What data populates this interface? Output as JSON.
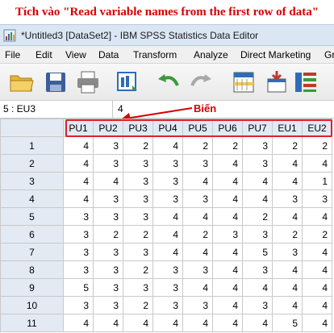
{
  "caption": "Tích vào \"Read variable names from the first row of data\"",
  "window": {
    "title": "*Untitled3 [DataSet2] - IBM SPSS Statistics Data Editor"
  },
  "menu": [
    "File",
    "Edit",
    "View",
    "Data",
    "Transform",
    "Analyze",
    "Direct Marketing",
    "Gr"
  ],
  "toolbar": {
    "icons": [
      "open-folder-icon",
      "save-icon",
      "print-icon",
      "recall-dialog-icon",
      "undo-icon",
      "redo-icon",
      "goto-case-icon",
      "goto-variable-icon",
      "variables-icon"
    ]
  },
  "cell_editor": {
    "ref": "5 : EU3",
    "value": "4"
  },
  "annotation": {
    "label": "Biến",
    "color": "#d40000"
  },
  "grid": {
    "columns": [
      "PU1",
      "PU2",
      "PU3",
      "PU4",
      "PU5",
      "PU6",
      "PU7",
      "EU1",
      "EU2"
    ],
    "rows": [
      {
        "num": "1",
        "cells": [
          "4",
          "3",
          "2",
          "4",
          "2",
          "2",
          "3",
          "2",
          "2"
        ]
      },
      {
        "num": "2",
        "cells": [
          "4",
          "3",
          "3",
          "3",
          "3",
          "4",
          "3",
          "4",
          "4"
        ]
      },
      {
        "num": "3",
        "cells": [
          "4",
          "4",
          "3",
          "3",
          "4",
          "4",
          "4",
          "4",
          "1"
        ]
      },
      {
        "num": "4",
        "cells": [
          "4",
          "3",
          "3",
          "3",
          "3",
          "4",
          "4",
          "3",
          "3"
        ]
      },
      {
        "num": "5",
        "cells": [
          "3",
          "3",
          "3",
          "4",
          "4",
          "4",
          "2",
          "4",
          "4"
        ]
      },
      {
        "num": "6",
        "cells": [
          "3",
          "2",
          "2",
          "4",
          "2",
          "3",
          "3",
          "2",
          "2"
        ]
      },
      {
        "num": "7",
        "cells": [
          "3",
          "3",
          "3",
          "4",
          "4",
          "4",
          "5",
          "3",
          "4"
        ]
      },
      {
        "num": "8",
        "cells": [
          "3",
          "3",
          "2",
          "3",
          "3",
          "4",
          "3",
          "4",
          "4"
        ]
      },
      {
        "num": "9",
        "cells": [
          "5",
          "3",
          "3",
          "3",
          "4",
          "4",
          "4",
          "4",
          "4"
        ]
      },
      {
        "num": "10",
        "cells": [
          "3",
          "3",
          "2",
          "3",
          "3",
          "4",
          "3",
          "4",
          "4"
        ]
      },
      {
        "num": "11",
        "cells": [
          "4",
          "4",
          "4",
          "4",
          "4",
          "4",
          "4",
          "5",
          "4"
        ]
      }
    ]
  }
}
